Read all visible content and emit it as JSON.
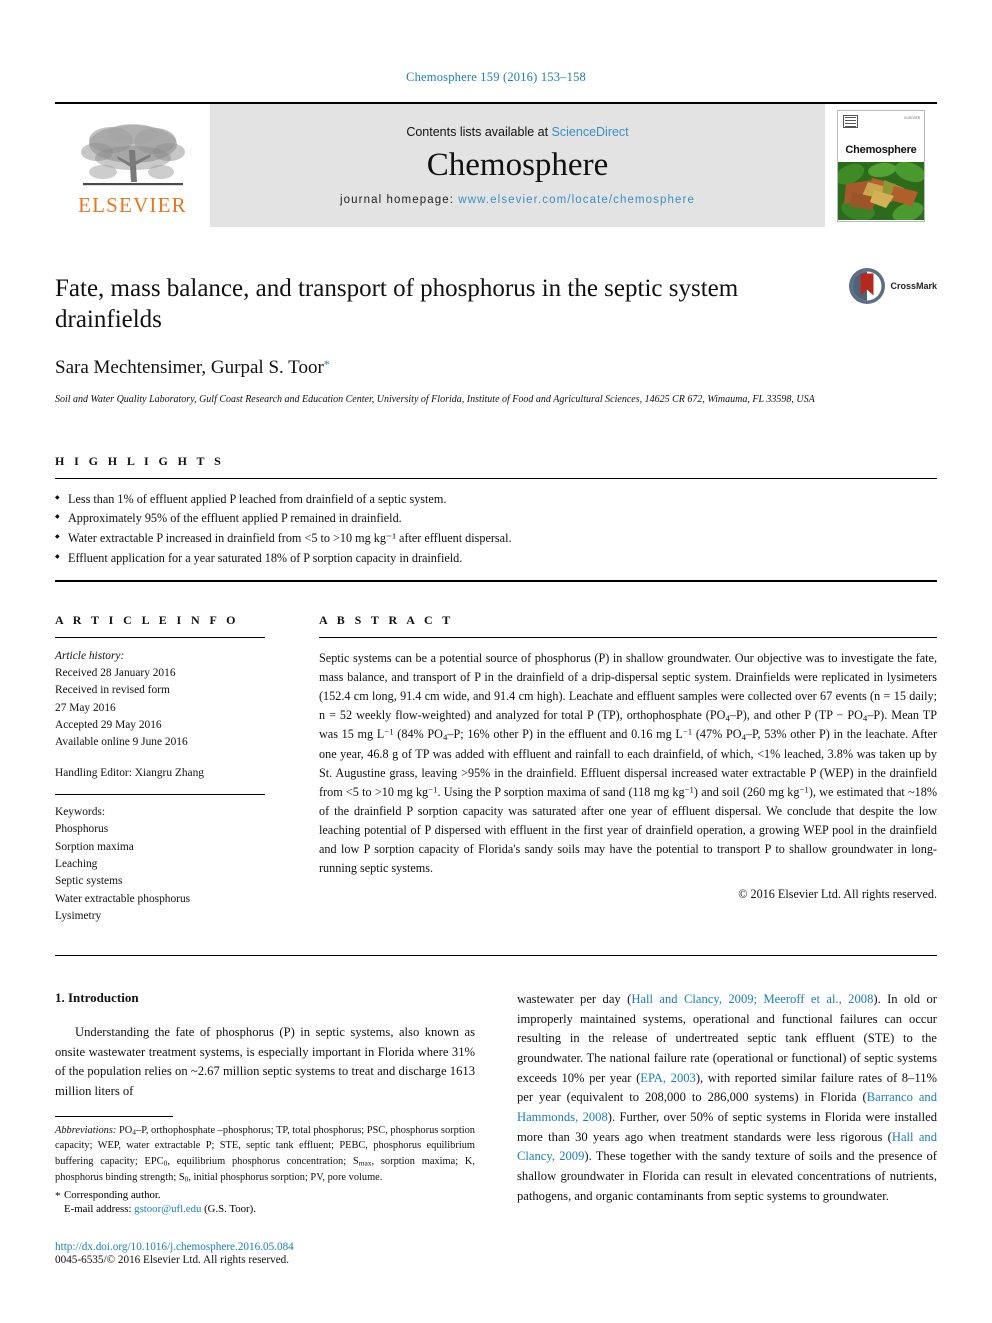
{
  "journal_ref": "Chemosphere 159 (2016) 153–158",
  "masthead": {
    "publisher_wordmark": "ELSEVIER",
    "contents_prefix": "Contents lists available at ",
    "contents_link": "ScienceDirect",
    "journal_name": "Chemosphere",
    "homepage_prefix": "journal homepage: ",
    "homepage_url": "www.elsevier.com/locate/chemosphere",
    "cover_title": "Chemosphere",
    "cover_corner_text": "ELSEVIER"
  },
  "article": {
    "title": "Fate, mass balance, and transport of phosphorus in the septic system drainfields",
    "authors": "Sara Mechtensimer, Gurpal S. Toor",
    "author_marker": "*",
    "affiliation": "Soil and Water Quality Laboratory, Gulf Coast Research and Education Center, University of Florida, Institute of Food and Agricultural Sciences, 14625 CR 672, Wimauma, FL 33598, USA",
    "crossmark_label": "CrossMark"
  },
  "highlights": {
    "label": "H I G H L I G H T S",
    "items": [
      "Less than 1% of effluent applied P leached from drainfield of a septic system.",
      "Approximately 95% of the effluent applied P remained in drainfield.",
      "Water extractable P increased in drainfield from <5 to >10 mg kg⁻¹ after effluent dispersal.",
      "Effluent application for a year saturated 18% of P sorption capacity in drainfield."
    ]
  },
  "article_info": {
    "label": "A R T I C L E  I N F O",
    "history_label": "Article history:",
    "history": [
      "Received 28 January 2016",
      "Received in revised form",
      "27 May 2016",
      "Accepted 29 May 2016",
      "Available online 9 June 2016"
    ],
    "handling_editor": "Handling Editor: Xiangru Zhang",
    "keywords_label": "Keywords:",
    "keywords": [
      "Phosphorus",
      "Sorption maxima",
      "Leaching",
      "Septic systems",
      "Water extractable phosphorus",
      "Lysimetry"
    ]
  },
  "abstract": {
    "label": "A B S T R A C T",
    "copyright": "© 2016 Elsevier Ltd. All rights reserved."
  },
  "introduction": {
    "heading": "1. Introduction"
  },
  "footnotes": {
    "abbrev_label": "Abbreviations:",
    "corresponding": "Corresponding author.",
    "email_label": "E-mail address:",
    "email": "gstoor@ufl.edu",
    "email_suffix": " (G.S. Toor)."
  },
  "footer": {
    "doi": "http://dx.doi.org/10.1016/j.chemosphere.2016.05.084",
    "issn_line": "0045-6535/© 2016 Elsevier Ltd. All rights reserved."
  },
  "colors": {
    "link": "#1a7fb5",
    "elsevier_orange": "#E87722",
    "masthead_bg": "#e3e3e3",
    "sciencedirect_blue": "#3a8fc4"
  }
}
